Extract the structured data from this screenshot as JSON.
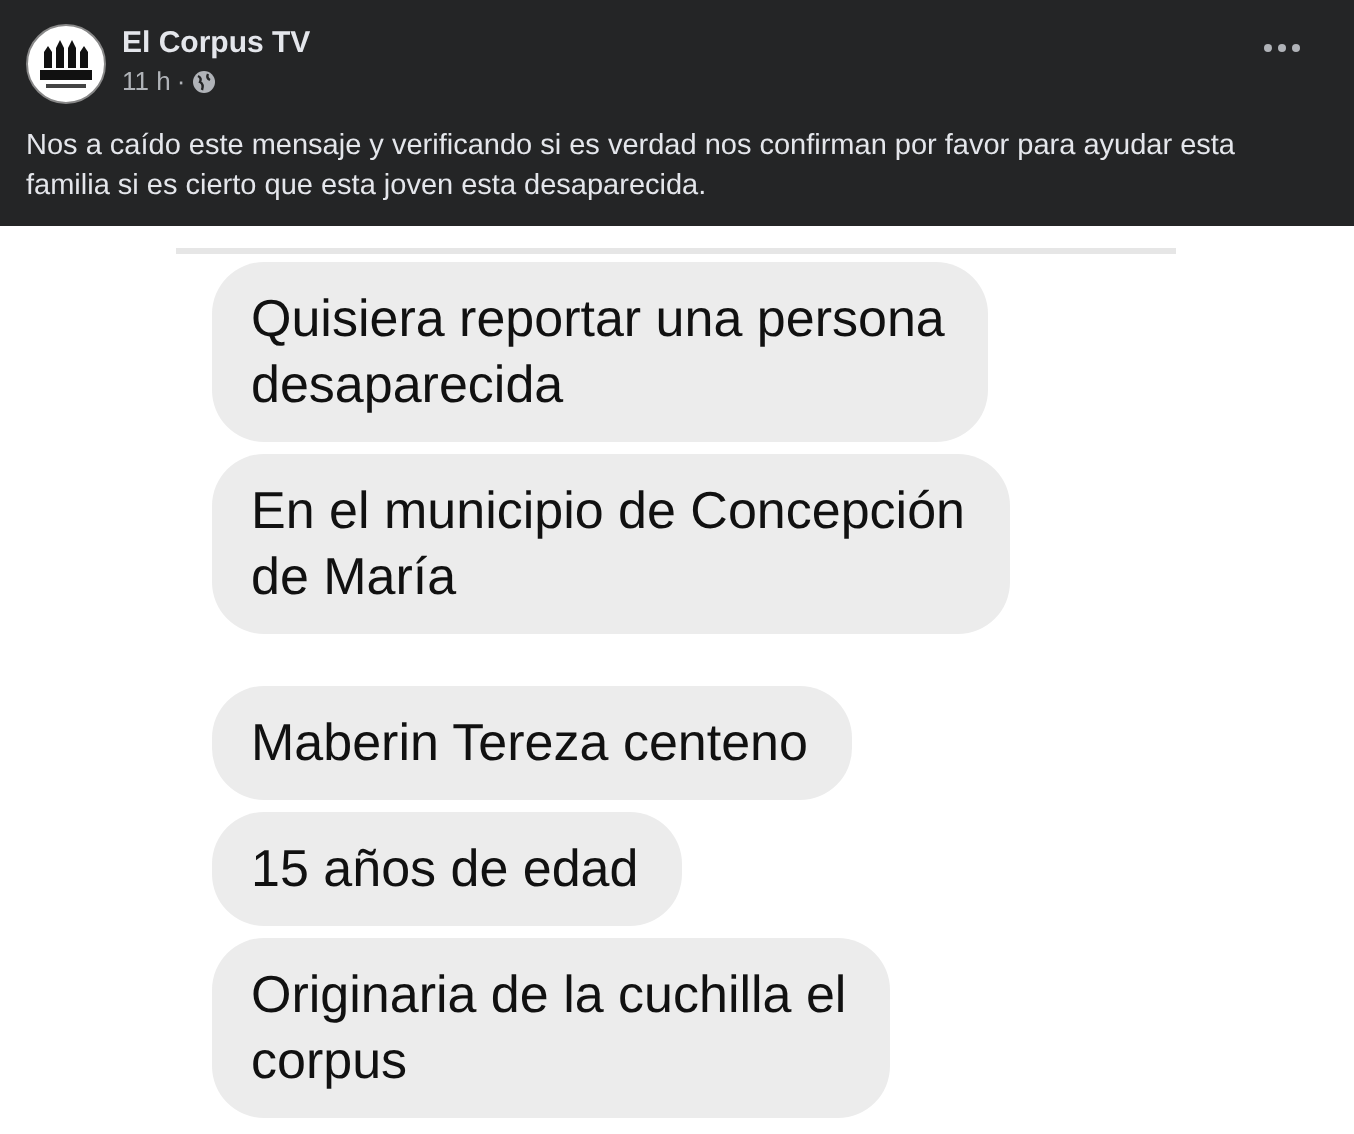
{
  "post": {
    "author": "El Corpus TV",
    "time": "11 h",
    "separator": "·",
    "caption": "Nos a caído este mensaje y verificando si es verdad nos confirman por favor para ayudar esta familia si es cierto que esta joven esta desaparecida."
  },
  "messages": [
    {
      "lines": [
        "Quisiera reportar una persona",
        "desaparecida"
      ]
    },
    {
      "lines": [
        "En el municipio de Concepción",
        "de María"
      ]
    },
    {
      "lines": [
        "Maberin Tereza centeno"
      ]
    },
    {
      "lines": [
        "15 años de edad"
      ]
    },
    {
      "lines": [
        "Originaria de la cuchilla el",
        "corpus"
      ]
    }
  ]
}
